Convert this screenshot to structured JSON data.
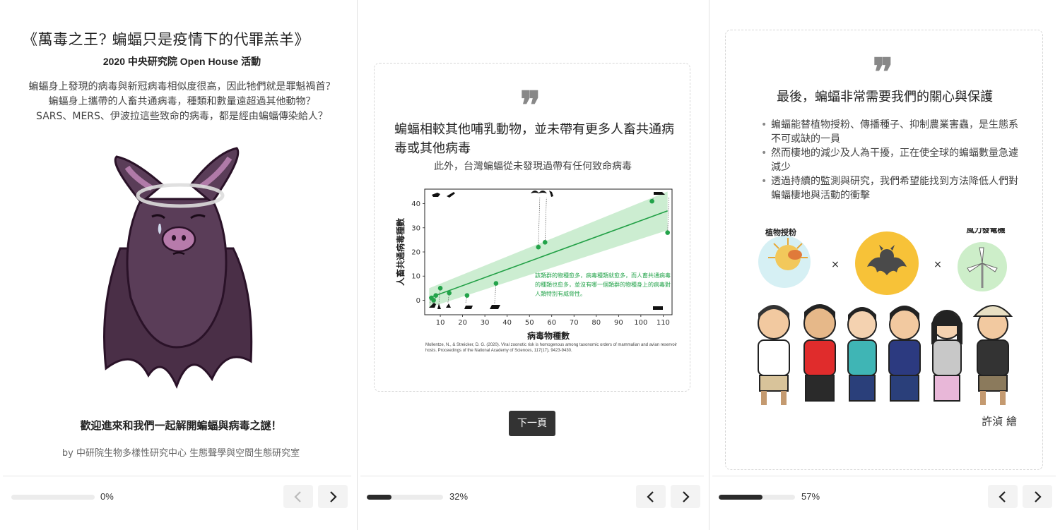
{
  "panel1": {
    "title": "《萬毒之王? 蝙蝠只是疫情下的代罪羔羊》",
    "subtitle": "2020 中央研究院 Open House 活動",
    "intro_lines": [
      "蝙蝠身上發現的病毒與新冠病毒相似度很高，因此牠們就是罪魁禍首？",
      "蝙蝠身上攜帶的人畜共通病毒，種類和數量遠超過其他動物？",
      "SARS、MERS、伊波拉這些致命的病毒，都是經由蝙蝠傳染給人？"
    ],
    "welcome": "歡迎進來和我們一起解開蝙蝠與病毒之謎！",
    "byline": "by 中研院生物多樣性研究中心 生態聲學與空間生態研究室",
    "progress_text": "0%",
    "progress_value": 0
  },
  "panel2": {
    "quote_mark": "❞",
    "heading": "蝙蝠相較其他哺乳動物，並未帶有更多人畜共通病毒或其他病毒",
    "subheading": "此外，台灣蝙蝠從未發現過帶有任何致命病毒",
    "next_button": "下一頁",
    "progress_text": "32%",
    "progress_value": 0.32
  },
  "panel3": {
    "quote_mark": "❞",
    "heading": "最後，蝙蝠非常需要我們的關心與保護",
    "bullets": [
      "蝙蝠能替植物授粉、傳播種子、抑制農業害蟲，是生態系不可或缺的一員",
      "然而棲地的減少及人為干擾，正在使全球的蝙蝠數量急遽減少",
      "透過持續的監測與研究，我們希望能找到方法降低人們對蝙蝠棲地與活動的衝擊"
    ],
    "badges": [
      "植物授粉",
      "蝙蝠",
      "風力發電機"
    ],
    "multiply": "×",
    "artist": "許湞 繪",
    "progress_text": "57%",
    "progress_value": 0.57
  },
  "chart_data": {
    "type": "scatter",
    "xlabel": "病毒物種數",
    "ylabel": "人畜共通病毒種數",
    "x_ticks": [
      10,
      20,
      30,
      40,
      50,
      60,
      70,
      80,
      90,
      100,
      110
    ],
    "y_ticks": [
      0,
      10,
      20,
      30,
      40
    ],
    "xlim": [
      3,
      114
    ],
    "ylim": [
      -6,
      46
    ],
    "points": [
      {
        "x": 6,
        "y": 1
      },
      {
        "x": 7,
        "y": 0
      },
      {
        "x": 8,
        "y": 2
      },
      {
        "x": 10,
        "y": 5
      },
      {
        "x": 14,
        "y": 3
      },
      {
        "x": 22,
        "y": 2
      },
      {
        "x": 35,
        "y": 7
      },
      {
        "x": 54,
        "y": 22
      },
      {
        "x": 57,
        "y": 24
      },
      {
        "x": 105,
        "y": 41
      },
      {
        "x": 112,
        "y": 28
      }
    ],
    "fit": {
      "x0": 5,
      "y0": 1,
      "x1": 112,
      "y1": 37
    },
    "annotation": "該類群的物種愈多，病毒種類就愈多，而人畜共通病毒的種類也愈多，並沒有哪一個類群的物種身上的病毒對人類特別有威脅性。",
    "citation": "Mollentze, N., & Streicker, D. G. (2020). Viral zoonotic risk is homogenous among taxonomic orders of mammalian and avian reservoir hosts. Proceedings of the National Academy of Sciences, 117(17), 9423-9430.",
    "grid": false,
    "colors": {
      "points": "#23a34a",
      "fit": "#22a046",
      "band": "#bfe8c6"
    }
  }
}
